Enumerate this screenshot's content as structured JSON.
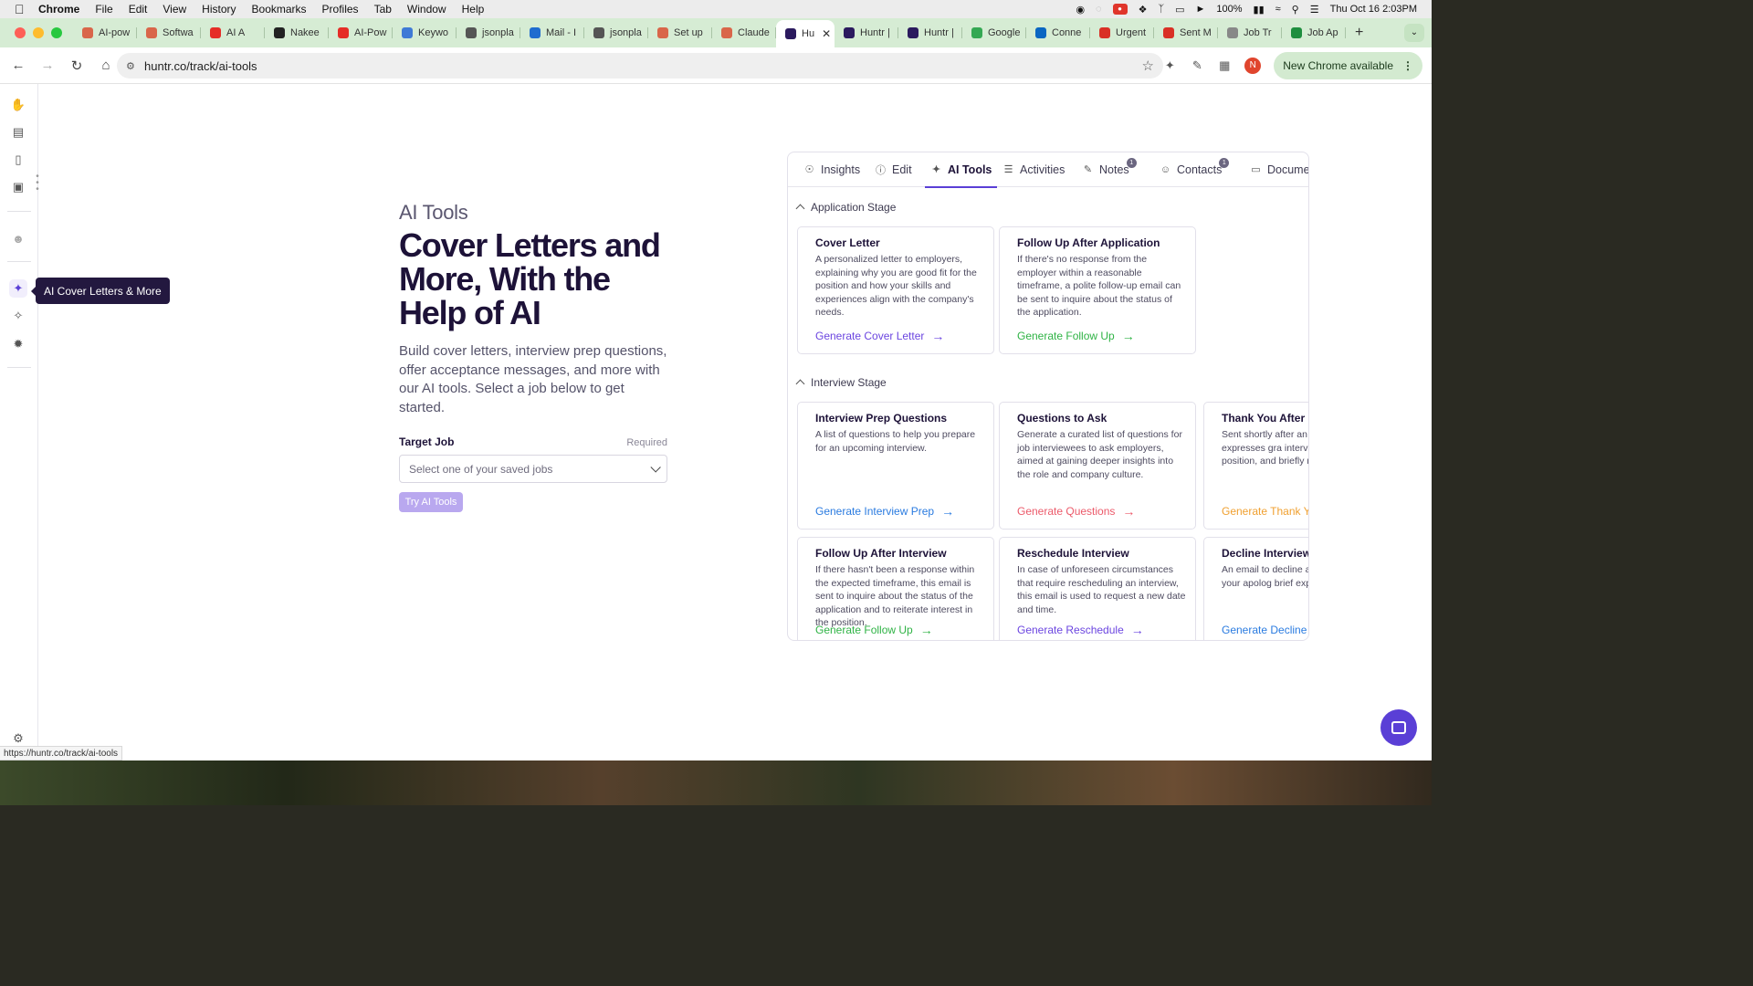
{
  "menubar": {
    "app": "Chrome",
    "items": [
      "File",
      "Edit",
      "View",
      "History",
      "Bookmarks",
      "Profiles",
      "Tab",
      "Window",
      "Help"
    ],
    "battery": "100%",
    "datetime": "Thu Oct 16  2:03PM"
  },
  "tabs": [
    {
      "label": "AI-pow",
      "favicon": "claude-icon",
      "color": "#d9664a"
    },
    {
      "label": "Softwa",
      "favicon": "claude-icon",
      "color": "#d9664a"
    },
    {
      "label": "AI A",
      "favicon": "youtube-icon",
      "color": "#e52d27"
    },
    {
      "label": "Nakee",
      "favicon": "github-icon",
      "color": "#222222"
    },
    {
      "label": "AI-Pow",
      "favicon": "youtube-icon",
      "color": "#e52d27"
    },
    {
      "label": "Keywo",
      "favicon": "chart-icon",
      "color": "#3f7ad6"
    },
    {
      "label": "jsonpla",
      "favicon": "json-icon",
      "color": "#555555"
    },
    {
      "label": "Mail - I",
      "favicon": "outlook-icon",
      "color": "#1f6ccf"
    },
    {
      "label": "jsonpla",
      "favicon": "json-icon",
      "color": "#555555"
    },
    {
      "label": "Set up",
      "favicon": "claude-icon",
      "color": "#d9664a"
    },
    {
      "label": "Claude",
      "favicon": "claude-icon",
      "color": "#d9664a"
    },
    {
      "label": "Hu",
      "favicon": "huntr-icon",
      "color": "#2b1a5e",
      "active": true
    },
    {
      "label": "Huntr |",
      "favicon": "huntr-icon",
      "color": "#2b1a5e"
    },
    {
      "label": "Huntr |",
      "favicon": "huntr-icon",
      "color": "#2b1a5e"
    },
    {
      "label": "Google",
      "favicon": "maps-icon",
      "color": "#34a853"
    },
    {
      "label": "Conne",
      "favicon": "linkedin-icon",
      "color": "#0a66c2"
    },
    {
      "label": "Urgent",
      "favicon": "gmail-icon",
      "color": "#d93025"
    },
    {
      "label": "Sent M",
      "favicon": "gmail-icon",
      "color": "#d93025"
    },
    {
      "label": "Job Tr",
      "favicon": "globe-icon",
      "color": "#888888"
    },
    {
      "label": "Job Ap",
      "favicon": "sheet-icon",
      "color": "#1e8e3e"
    }
  ],
  "toolbar": {
    "url": "huntr.co/track/ai-tools",
    "update_label": "New Chrome available",
    "profile_initial": "N"
  },
  "rail": {
    "tooltip": "AI Cover Letters & More"
  },
  "hero": {
    "kicker": "AI Tools",
    "title": "Cover Letters and More, With the Help of AI",
    "description": "Build cover letters, interview prep questions, offer acceptance messages, and more with our AI tools. Select a job below to get started.",
    "field_label": "Target Job",
    "field_required": "Required",
    "select_placeholder": "Select one of your saved jobs",
    "button": "Try AI Tools"
  },
  "panel": {
    "tabs": [
      {
        "label": "Insights",
        "icon": "lightbulb-icon"
      },
      {
        "label": "Edit",
        "icon": "info-icon"
      },
      {
        "label": "AI Tools",
        "icon": "sparkle-icon",
        "active": true
      },
      {
        "label": "Activities",
        "icon": "list-icon"
      },
      {
        "label": "Notes",
        "icon": "pencil-icon",
        "badge": "1"
      },
      {
        "label": "Contacts",
        "icon": "person-icon",
        "badge": "1"
      },
      {
        "label": "Documen",
        "icon": "folder-icon"
      }
    ],
    "sections": [
      {
        "title": "Application Stage",
        "cards": [
          {
            "title": "Cover Letter",
            "desc": "A personalized letter to employers, explaining why you are good fit for the position and how your skills and experiences align with the company's needs.",
            "link": "Generate Cover Letter",
            "color": "#6b45e0"
          },
          {
            "title": "Follow Up After Application",
            "desc": "If there's no response from the employer within a reasonable timeframe, a polite follow-up email can be sent to inquire about the status of the application.",
            "link": "Generate Follow Up",
            "color": "#2fb345"
          }
        ]
      },
      {
        "title": "Interview Stage",
        "cards": [
          {
            "title": "Interview Prep Questions",
            "desc": "A list of questions to help you prepare for an upcoming interview.",
            "link": "Generate Interview Prep",
            "color": "#2a7be0"
          },
          {
            "title": "Questions to Ask",
            "desc": "Generate a curated list of questions for job interviewees to ask employers, aimed at gaining deeper insights into the role and company culture.",
            "link": "Generate Questions",
            "color": "#ec5a6a"
          },
          {
            "title": "Thank You After Inte",
            "desc": "Sent shortly after an in message expresses gra interview, reinforces yo position, and briefly res are a good fit.",
            "link": "Generate Thank You",
            "color": "#f0a030"
          },
          {
            "title": "Follow Up After Interview",
            "desc": "If there hasn't been a response within the expected timeframe, this email is sent to inquire about the status of the application and to reiterate interest in the position.",
            "link": "Generate Follow Up",
            "color": "#2fb345"
          },
          {
            "title": "Reschedule Interview",
            "desc": "In case of unforeseen circumstances that require rescheduling an interview, this email is used to request a new date and time.",
            "link": "Generate Reschedule",
            "color": "#6b45e0"
          },
          {
            "title": "Decline Interview",
            "desc": "An email to decline an i expressing your apolog brief explanation for yo",
            "link": "Generate Decline",
            "color": "#2a7be0"
          }
        ]
      }
    ]
  },
  "status_url": "https://huntr.co/track/ai-tools"
}
